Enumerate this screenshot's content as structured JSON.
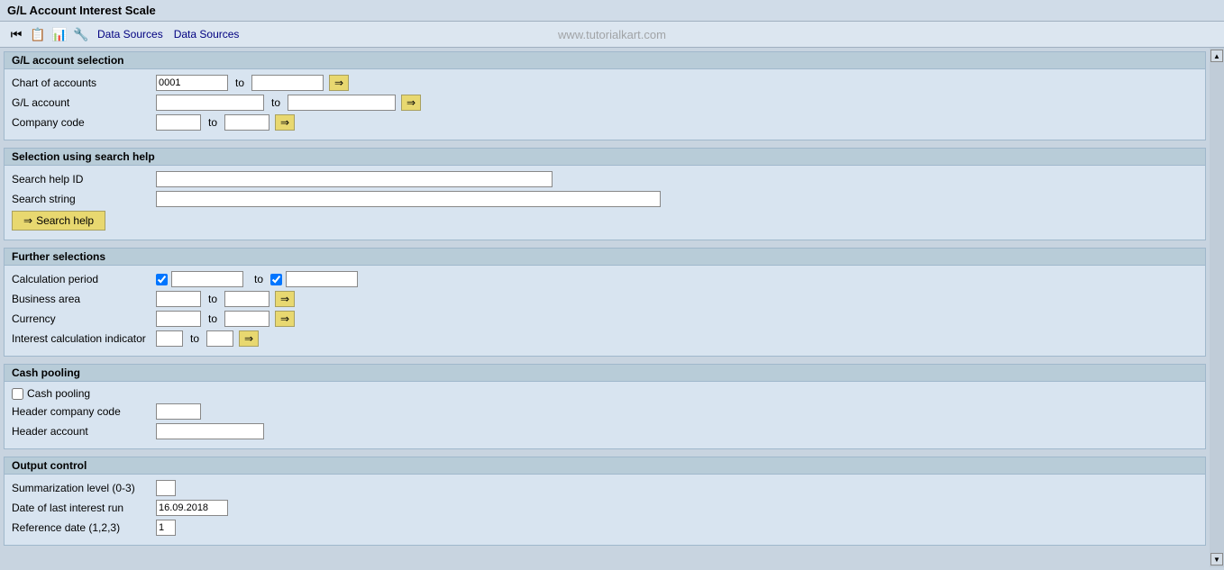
{
  "title": "G/L Account Interest Scale",
  "toolbar": {
    "icons": [
      "⏮",
      "📋",
      "📊",
      "🔧"
    ],
    "menus": [
      "Data Sources",
      "Data Sources"
    ],
    "watermark": "www.tutorialkart.com"
  },
  "sections": {
    "gl_account_selection": {
      "header": "G/L account selection",
      "fields": {
        "chart_of_accounts": {
          "label": "Chart of accounts",
          "value_from": "0001",
          "value_to": "",
          "has_arrow": true
        },
        "gl_account": {
          "label": "G/L account",
          "value_from": "",
          "value_to": "",
          "has_arrow": true
        },
        "company_code": {
          "label": "Company code",
          "value_from": "",
          "value_to": "",
          "has_arrow": true
        }
      }
    },
    "search_help": {
      "header": "Selection using search help",
      "fields": {
        "search_help_id": {
          "label": "Search help ID",
          "value": ""
        },
        "search_string": {
          "label": "Search string",
          "value": ""
        }
      },
      "button": "Search help"
    },
    "further_selections": {
      "header": "Further selections",
      "fields": {
        "calculation_period": {
          "label": "Calculation period",
          "value_from": "",
          "value_to": "",
          "has_checkbox": true
        },
        "business_area": {
          "label": "Business area",
          "value_from": "",
          "value_to": "",
          "has_arrow": true
        },
        "currency": {
          "label": "Currency",
          "value_from": "",
          "value_to": "",
          "has_arrow": true
        },
        "interest_calc_indicator": {
          "label": "Interest calculation indicator",
          "value_from": "",
          "value_to": "",
          "has_arrow": true
        }
      }
    },
    "cash_pooling": {
      "header": "Cash pooling",
      "fields": {
        "cash_pooling_checkbox": {
          "label": "Cash pooling",
          "checked": false
        },
        "header_company_code": {
          "label": "Header company code",
          "value": ""
        },
        "header_account": {
          "label": "Header account",
          "value": ""
        }
      }
    },
    "output_control": {
      "header": "Output control",
      "fields": {
        "summarization_level": {
          "label": "Summarization level (0-3)",
          "value": ""
        },
        "date_last_interest_run": {
          "label": "Date of last interest run",
          "value": "16.09.2018"
        },
        "reference_date": {
          "label": "Reference date (1,2,3)",
          "value": "1"
        }
      }
    }
  }
}
